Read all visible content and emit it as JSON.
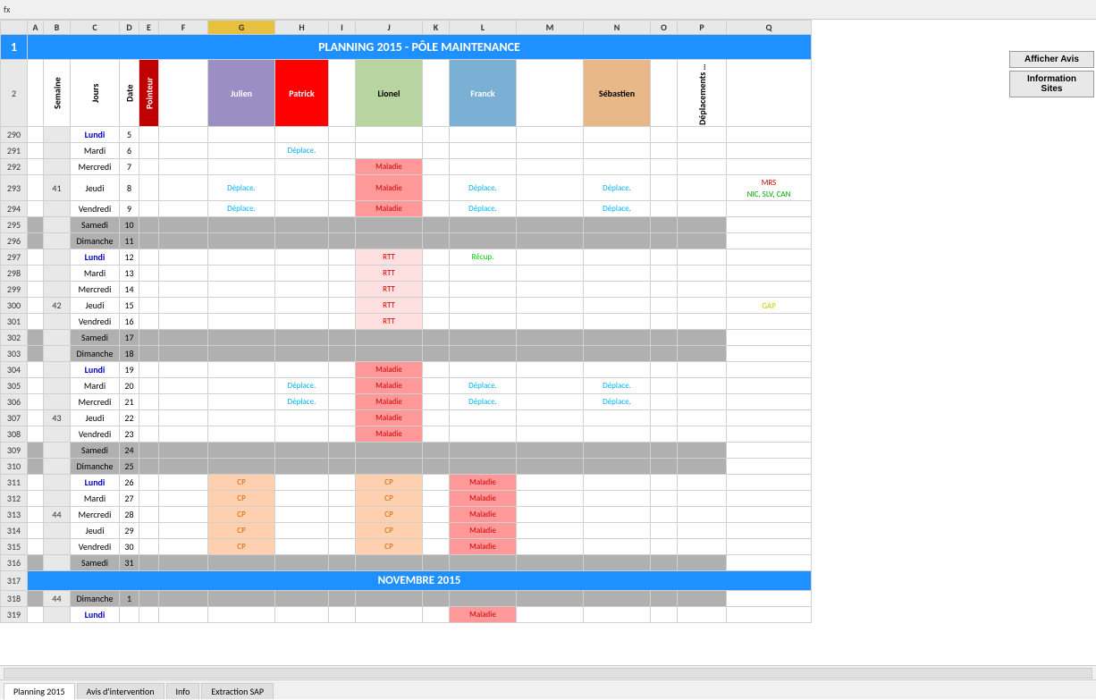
{
  "title": "PLANNING 2015 - PÔLE MAINTENANCE",
  "buttons": {
    "afficher_avis": "Afficher Avis",
    "information_sites": "Information Sites"
  },
  "columns": {
    "letters": [
      "",
      "A",
      "B",
      "C",
      "D",
      "E",
      "F",
      "G",
      "H",
      "I",
      "J",
      "K",
      "L",
      "M",
      "N",
      "O",
      "P",
      "Q"
    ],
    "headers": {
      "semaine": "Semaine",
      "jours": "Jours",
      "date": "Date",
      "pointeur": "Pointeur",
      "julien": "Julien",
      "patrick": "Patrick",
      "lionel": "Lionel",
      "franck": "Franck",
      "sebastien": "Sébastien",
      "deplacements": "Déplacements prévisionnels"
    }
  },
  "rows": [
    {
      "rn": "290",
      "week": "",
      "day": "Lundi",
      "date": "5",
      "f": "",
      "g": "",
      "h": "",
      "i": "",
      "j": "",
      "k": "",
      "l": "",
      "m": "",
      "n": "",
      "info": "",
      "type": "normal"
    },
    {
      "rn": "291",
      "week": "",
      "day": "Mardi",
      "date": "6",
      "f": "",
      "g": "",
      "h": "Déplace.",
      "i": "",
      "j": "",
      "k": "",
      "l": "",
      "m": "",
      "n": "",
      "info": "",
      "type": "normal"
    },
    {
      "rn": "292",
      "week": "",
      "day": "Mercredi",
      "date": "7",
      "f": "",
      "g": "",
      "h": "",
      "i": "",
      "j": "Maladie",
      "k": "",
      "l": "",
      "m": "",
      "n": "",
      "info": "",
      "type": "normal"
    },
    {
      "rn": "293",
      "week": "41",
      "day": "Jeudi",
      "date": "8",
      "f": "",
      "g": "Déplace.",
      "h": "",
      "i": "",
      "j": "Maladie",
      "k": "",
      "l": "Déplace.",
      "m": "",
      "n": "Déplace.",
      "info": "",
      "type": "normal"
    },
    {
      "rn": "294",
      "week": "",
      "day": "Vendredi",
      "date": "9",
      "f": "",
      "g": "Déplace.",
      "h": "",
      "i": "",
      "j": "Maladie",
      "k": "",
      "l": "Déplace.",
      "m": "",
      "n": "Déplace.",
      "info": "",
      "type": "vendredi"
    },
    {
      "rn": "295",
      "week": "",
      "day": "Samedi",
      "date": "10",
      "f": "",
      "g": "",
      "h": "",
      "i": "",
      "j": "",
      "k": "",
      "l": "",
      "m": "",
      "n": "",
      "info": "",
      "type": "weekend"
    },
    {
      "rn": "296",
      "week": "",
      "day": "Dimanche",
      "date": "11",
      "f": "",
      "g": "",
      "h": "",
      "i": "",
      "j": "",
      "k": "",
      "l": "",
      "m": "",
      "n": "",
      "info": "",
      "type": "weekend"
    },
    {
      "rn": "297",
      "week": "",
      "day": "Lundi",
      "date": "12",
      "f": "",
      "g": "",
      "h": "",
      "i": "",
      "j": "RTT",
      "k": "",
      "l": "Récup.",
      "m": "",
      "n": "",
      "info": "",
      "type": "normal"
    },
    {
      "rn": "298",
      "week": "",
      "day": "Mardi",
      "date": "13",
      "f": "",
      "g": "",
      "h": "",
      "i": "",
      "j": "RTT",
      "k": "",
      "l": "",
      "m": "",
      "n": "",
      "info": "",
      "type": "normal"
    },
    {
      "rn": "299",
      "week": "",
      "day": "Mercredi",
      "date": "14",
      "f": "",
      "g": "",
      "h": "",
      "i": "",
      "j": "RTT",
      "k": "",
      "l": "",
      "m": "",
      "n": "",
      "info": "",
      "type": "normal"
    },
    {
      "rn": "300",
      "week": "42",
      "day": "Jeudi",
      "date": "15",
      "f": "",
      "g": "",
      "h": "",
      "i": "",
      "j": "RTT",
      "k": "",
      "l": "",
      "m": "",
      "n": "",
      "info": "GAP",
      "type": "normal"
    },
    {
      "rn": "301",
      "week": "",
      "day": "Vendredi",
      "date": "16",
      "f": "",
      "g": "",
      "h": "",
      "i": "",
      "j": "RTT",
      "k": "",
      "l": "",
      "m": "",
      "n": "",
      "info": "",
      "type": "vendredi"
    },
    {
      "rn": "302",
      "week": "",
      "day": "Samedi",
      "date": "17",
      "f": "",
      "g": "",
      "h": "",
      "i": "",
      "j": "",
      "k": "",
      "l": "",
      "m": "",
      "n": "",
      "info": "",
      "type": "weekend"
    },
    {
      "rn": "303",
      "week": "",
      "day": "Dimanche",
      "date": "18",
      "f": "",
      "g": "",
      "h": "",
      "i": "",
      "j": "",
      "k": "",
      "l": "",
      "m": "",
      "n": "",
      "info": "",
      "type": "weekend"
    },
    {
      "rn": "304",
      "week": "",
      "day": "Lundi",
      "date": "19",
      "f": "",
      "g": "",
      "h": "",
      "i": "",
      "j": "Maladie",
      "k": "",
      "l": "",
      "m": "",
      "n": "",
      "info": "",
      "type": "normal"
    },
    {
      "rn": "305",
      "week": "",
      "day": "Mardi",
      "date": "20",
      "f": "",
      "g": "",
      "h": "Déplace.",
      "i": "",
      "j": "Maladie",
      "k": "",
      "l": "Déplace.",
      "m": "",
      "n": "Déplace.",
      "info": "",
      "type": "normal"
    },
    {
      "rn": "306",
      "week": "",
      "day": "Mercredi",
      "date": "21",
      "f": "",
      "g": "",
      "h": "Déplace.",
      "i": "",
      "j": "Maladie",
      "k": "",
      "l": "Déplace.",
      "m": "",
      "n": "Déplace.",
      "info": "",
      "type": "normal"
    },
    {
      "rn": "307",
      "week": "43",
      "day": "Jeudi",
      "date": "22",
      "f": "",
      "g": "",
      "h": "",
      "i": "",
      "j": "Maladie",
      "k": "",
      "l": "",
      "m": "",
      "n": "",
      "info": "",
      "type": "normal"
    },
    {
      "rn": "308",
      "week": "",
      "day": "Vendredi",
      "date": "23",
      "f": "",
      "g": "",
      "h": "",
      "i": "",
      "j": "Maladie",
      "k": "",
      "l": "",
      "m": "",
      "n": "",
      "info": "",
      "type": "vendredi"
    },
    {
      "rn": "309",
      "week": "",
      "day": "Samedi",
      "date": "24",
      "f": "",
      "g": "",
      "h": "",
      "i": "",
      "j": "",
      "k": "",
      "l": "",
      "m": "",
      "n": "",
      "info": "",
      "type": "weekend"
    },
    {
      "rn": "310",
      "week": "",
      "day": "Dimanche",
      "date": "25",
      "f": "",
      "g": "",
      "h": "",
      "i": "",
      "j": "",
      "k": "",
      "l": "",
      "m": "",
      "n": "",
      "info": "",
      "type": "weekend"
    },
    {
      "rn": "311",
      "week": "",
      "day": "Lundi",
      "date": "26",
      "f": "",
      "g": "CP",
      "h": "",
      "i": "",
      "j": "CP",
      "k": "",
      "l": "Maladie",
      "m": "",
      "n": "",
      "info": "",
      "type": "normal"
    },
    {
      "rn": "312",
      "week": "",
      "day": "Mardi",
      "date": "27",
      "f": "",
      "g": "CP",
      "h": "",
      "i": "",
      "j": "CP",
      "k": "",
      "l": "Maladie",
      "m": "",
      "n": "",
      "info": "",
      "type": "normal"
    },
    {
      "rn": "313",
      "week": "44",
      "day": "Mercredi",
      "date": "28",
      "f": "",
      "g": "CP",
      "h": "",
      "i": "",
      "j": "CP",
      "k": "",
      "l": "Maladie",
      "m": "",
      "n": "",
      "info": "",
      "type": "normal"
    },
    {
      "rn": "314",
      "week": "",
      "day": "Jeudi",
      "date": "29",
      "f": "",
      "g": "CP",
      "h": "",
      "i": "",
      "j": "CP",
      "k": "",
      "l": "Maladie",
      "m": "",
      "n": "",
      "info": "",
      "type": "normal"
    },
    {
      "rn": "315",
      "week": "",
      "day": "Vendredi",
      "date": "30",
      "f": "",
      "g": "CP",
      "h": "",
      "i": "",
      "j": "CP",
      "k": "",
      "l": "Maladie",
      "m": "",
      "n": "",
      "info": "",
      "type": "vendredi_red"
    },
    {
      "rn": "316",
      "week": "",
      "day": "Samedi",
      "date": "31",
      "f": "",
      "g": "",
      "h": "",
      "i": "",
      "j": "",
      "k": "",
      "l": "",
      "m": "",
      "n": "",
      "info": "",
      "type": "weekend"
    },
    {
      "rn": "317",
      "week": "",
      "day": "",
      "date": "",
      "f": "",
      "g": "",
      "h": "",
      "i": "",
      "j": "",
      "k": "",
      "l": "",
      "m": "",
      "n": "",
      "info": "",
      "type": "section",
      "label": "NOVEMBRE 2015"
    },
    {
      "rn": "318",
      "week": "44",
      "day": "Dimanche",
      "date": "1",
      "f": "",
      "g": "",
      "h": "",
      "i": "",
      "j": "",
      "k": "",
      "l": "",
      "m": "",
      "n": "",
      "info": "",
      "type": "weekend"
    },
    {
      "rn": "319",
      "week": "",
      "day": "Lundi",
      "date": "",
      "f": "",
      "g": "",
      "h": "",
      "i": "",
      "j": "",
      "k": "",
      "l": "Maladie",
      "m": "",
      "n": "",
      "info": "",
      "type": "normal"
    }
  ],
  "side_info": {
    "mrs": "MRS",
    "nic": "NIC, SLV, CAN",
    "gap": "GAP"
  },
  "tabs": [
    "Planning 2015",
    "Avis d'intervention",
    "Info",
    "Extraction SAP"
  ]
}
